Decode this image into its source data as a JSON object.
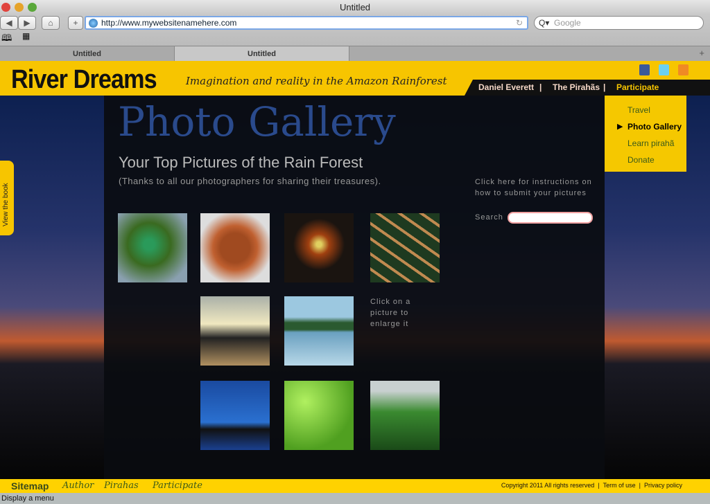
{
  "browser": {
    "title": "Untitled",
    "url": "http://www.mywebsitenamehere.com",
    "search_placeholder": "Google",
    "tabs": [
      {
        "label": "Untitled"
      },
      {
        "label": "Untitled"
      }
    ],
    "new_tab": "+",
    "status": "Display a menu"
  },
  "site": {
    "logo": "River Dreams",
    "tagline": "Imagination and reality in the Amazon Rainforest",
    "nav": [
      {
        "label": "Daniel Everett"
      },
      {
        "label": "The Pirahãs"
      },
      {
        "label": "Participate"
      }
    ],
    "nav_sep": "|",
    "social": [
      "facebook-icon",
      "twitter-icon",
      "rss-icon"
    ],
    "dropdown": [
      {
        "label": "Travel"
      },
      {
        "label": "Photo Gallery",
        "active": true
      },
      {
        "label": "Learn pirahã"
      },
      {
        "label": "Donate"
      }
    ],
    "view_book": "View the book"
  },
  "main": {
    "title": "Photo Gallery",
    "subtitle": "Your Top Pictures of the Rain Forest",
    "thanks": "(Thanks to all our photographers for sharing their treasures).",
    "instructions": "Click here for instructions on how to submit your pictures",
    "search_label": "Search",
    "enlarge": "Click on a picture to enlarge it"
  },
  "footer": {
    "links": [
      {
        "label": "Sitemap"
      },
      {
        "label": "Author"
      },
      {
        "label": "Pirahas"
      },
      {
        "label": "Participate"
      }
    ],
    "copyright": "Copyright 2011 All rights reserved",
    "terms": "Term of use",
    "privacy": "Privacy policy",
    "sep": "|"
  }
}
